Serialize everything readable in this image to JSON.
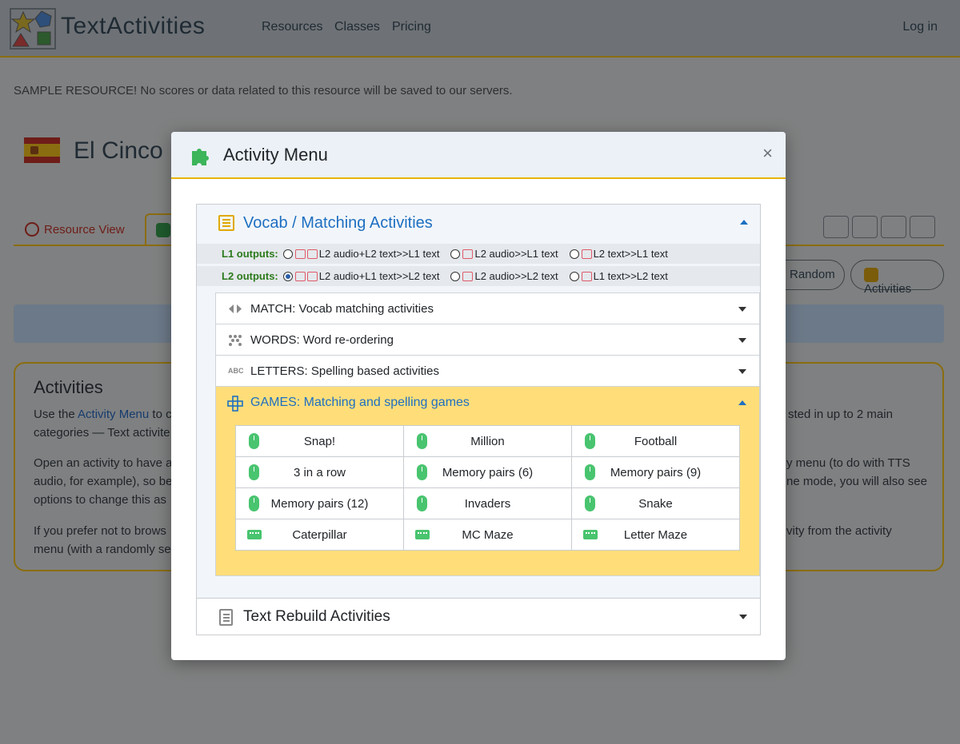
{
  "header": {
    "brand": "TextActivities",
    "nav": [
      "Resources",
      "Classes",
      "Pricing"
    ],
    "login": "Log in"
  },
  "page": {
    "sample_notice": "SAMPLE RESOURCE! No scores or data related to this resource will be saved to our servers.",
    "title": "El Cinco",
    "tab_resource_view": "Resource View",
    "pill_random": "Random",
    "pill_activities": "Activities",
    "activities_heading": "Activities",
    "para1_left_a": "Use the ",
    "para1_link": "Activity Menu",
    "para1_left_b": " to c",
    "para1_left_line2": "categories — Text activite",
    "para1_right": "sted in up to 2 main",
    "para2_left_line1": "Open an activity to have a",
    "para2_left_line2": "audio, for example), so be",
    "para2_left_line3": "options to change this as",
    "para2_right_line1": "y menu (to do with TTS",
    "para2_right_line2": "ne mode, you will also see",
    "para3_left_line1": "If you prefer not to brows",
    "para3_left_line2": "menu (with a randomly se",
    "para3_right": "vity from the activity"
  },
  "modal": {
    "title": "Activity Menu",
    "close": "×",
    "vocab_section": "Vocab / Matching Activities",
    "l1_label": "L1 outputs:",
    "l1_options": [
      "L2 audio+L2 text>>L1 text",
      "L2 audio>>L1 text",
      "L2 text>>L1 text"
    ],
    "l2_label": "L2 outputs:",
    "l2_options": [
      "L2 audio+L1 text>>L2 text",
      "L2 audio>>L2 text",
      "L1 text>>L2 text"
    ],
    "match": "MATCH: Vocab matching activities",
    "words": "WORDS: Word re-ordering",
    "letters": "LETTERS: Spelling based activities",
    "games": "GAMES: Matching and spelling games",
    "game_items": [
      [
        "Snap!",
        "Million",
        "Football"
      ],
      [
        "3 in a row",
        "Memory pairs (6)",
        "Memory pairs (9)"
      ],
      [
        "Memory pairs (12)",
        "Invaders",
        "Snake"
      ],
      [
        "Caterpillar",
        "MC Maze",
        "Letter Maze"
      ]
    ],
    "text_rebuild": "Text Rebuild Activities",
    "abc_icon_text": "ABC"
  },
  "icons": {
    "logo": "shapes-logo-icon",
    "puzzle": "puzzle-icon",
    "mouse": "mouse-icon",
    "keyboard": "keyboard-icon"
  },
  "colors": {
    "accent_yellow": "#e8b400",
    "link_blue": "#1e6fc1",
    "games_bg": "#ffde7a",
    "icon_green": "#49c46f",
    "label_green": "#2b7a1c"
  }
}
